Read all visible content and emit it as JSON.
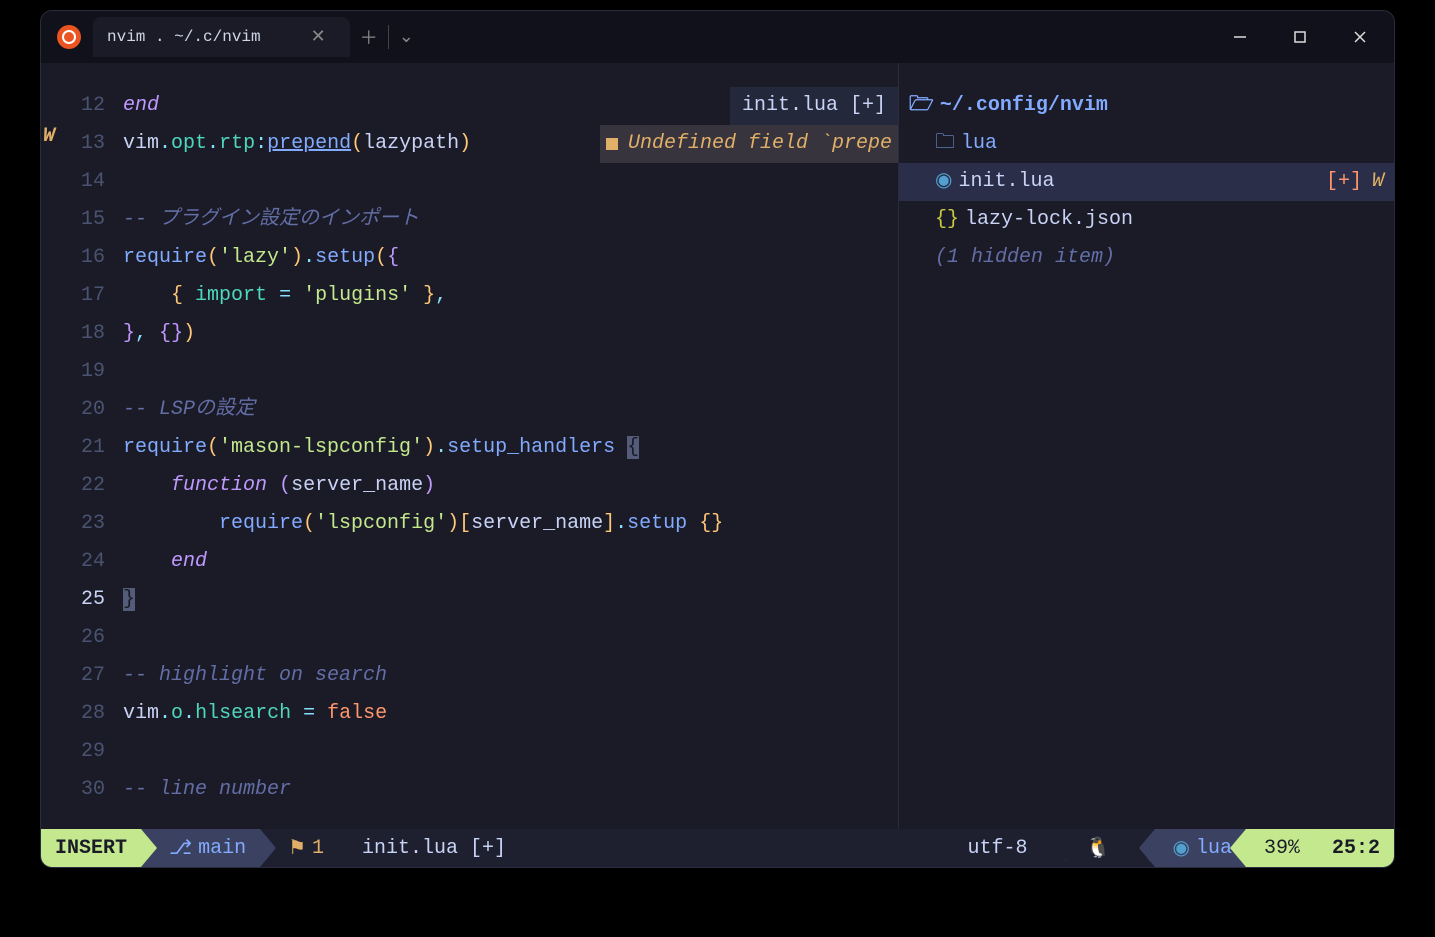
{
  "titlebar": {
    "tab_title": "nvim . ~/.c/nvim"
  },
  "winbar": {
    "filename": "init.lua",
    "modified": "[+]"
  },
  "diagnostic": {
    "text": "Undefined field `prepe"
  },
  "gutter": {
    "warn_sign": "W"
  },
  "lines": {
    "nums": [
      "12",
      "13",
      "14",
      "15",
      "16",
      "17",
      "18",
      "19",
      "20",
      "21",
      "22",
      "23",
      "24",
      "25",
      "26",
      "27",
      "28",
      "29",
      "30"
    ]
  },
  "code": {
    "l12_end": "end",
    "l13_vim": "vim",
    "l13_opt": "opt",
    "l13_rtp": "rtp",
    "l13_prepend": "prepend",
    "l13_lazypath": "lazypath",
    "l15_comment": "-- プラグイン設定のインポート",
    "l16_require": "require",
    "l16_lazy": "'lazy'",
    "l16_setup": "setup",
    "l17_import": "import",
    "l17_plugins": "'plugins'",
    "l18_close": "}, {})",
    "l20_comment": "-- LSPの設定",
    "l21_require": "require",
    "l21_mason": "'mason-lspconfig'",
    "l21_handlers": "setup_handlers",
    "l22_function": "function",
    "l22_server": "server_name",
    "l23_require": "require",
    "l23_lspconfig": "'lspconfig'",
    "l23_server": "server_name",
    "l23_setup": "setup",
    "l24_end": "end",
    "l27_comment": "-- highlight on search",
    "l28_vim": "vim",
    "l28_o": "o",
    "l28_hlsearch": "hlsearch",
    "l28_false": "false",
    "l30_comment": "-- line number"
  },
  "tree": {
    "root": "~/.config/nvim",
    "folder_lua": "lua",
    "file_init": "init.lua",
    "file_init_modified": "[+]",
    "file_init_warn": "W",
    "file_lazy": "lazy-lock.json",
    "hidden": "(1 hidden item)"
  },
  "statusline": {
    "mode": "INSERT",
    "branch": "main",
    "diag_count": "1",
    "filename": "init.lua [+]",
    "encoding": "utf-8",
    "filetype": "lua",
    "percent": "39%",
    "position": "25:2"
  }
}
